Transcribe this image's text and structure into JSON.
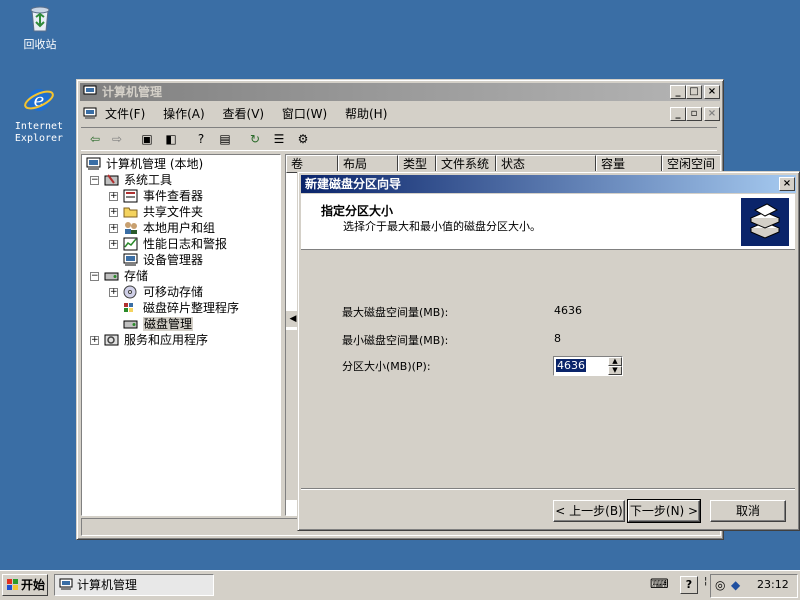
{
  "desktop": {
    "icons": [
      {
        "label": "回收站",
        "icon": "recycle-bin-icon"
      },
      {
        "label": "Internet",
        "label2": "Explorer",
        "icon": "ie-icon"
      }
    ]
  },
  "main_window": {
    "title": "计算机管理",
    "menu": [
      "文件(F)",
      "操作(A)",
      "查看(V)",
      "窗口(W)",
      "帮助(H)"
    ],
    "toolbar_icons": [
      "back-icon",
      "forward-icon",
      "up-folder-icon",
      "show-tree-icon",
      "help-icon",
      "action-pane-icon",
      "refresh-icon",
      "properties-icon",
      "export-icon"
    ],
    "tree": [
      {
        "label": "计算机管理 (本地)",
        "icon": "computer-icon"
      },
      {
        "label": "系统工具",
        "icon": "tools-icon"
      },
      {
        "label": "事件查看器",
        "icon": "event-viewer-icon"
      },
      {
        "label": "共享文件夹",
        "icon": "shared-folder-icon"
      },
      {
        "label": "本地用户和组",
        "icon": "users-icon"
      },
      {
        "label": "性能日志和警报",
        "icon": "perf-icon"
      },
      {
        "label": "设备管理器",
        "icon": "device-manager-icon"
      },
      {
        "label": "存储",
        "icon": "storage-icon"
      },
      {
        "label": "可移动存储",
        "icon": "removable-storage-icon"
      },
      {
        "label": "磁盘碎片整理程序",
        "icon": "defrag-icon"
      },
      {
        "label": "磁盘管理",
        "icon": "disk-management-icon"
      },
      {
        "label": "服务和应用程序",
        "icon": "services-icon"
      }
    ],
    "columns": [
      "卷",
      "布局",
      "类型",
      "文件系统",
      "状态",
      "容量",
      "空闲空间"
    ]
  },
  "wizard": {
    "title": "新建磁盘分区向导",
    "heading": "指定分区大小",
    "subheading": "选择介于最大和最小值的磁盘分区大小。",
    "max_label": "最大磁盘空间量(MB):",
    "max_value": "4636",
    "min_label": "最小磁盘空间量(MB):",
    "min_value": "8",
    "size_label": "分区大小(MB)(P):",
    "size_value": "4636",
    "back_button": "< 上一步(B)",
    "next_button": "下一步(N) >",
    "cancel_button": "取消"
  },
  "taskbar": {
    "start": "开始",
    "task": "计算机管理",
    "clock": "23:12"
  }
}
